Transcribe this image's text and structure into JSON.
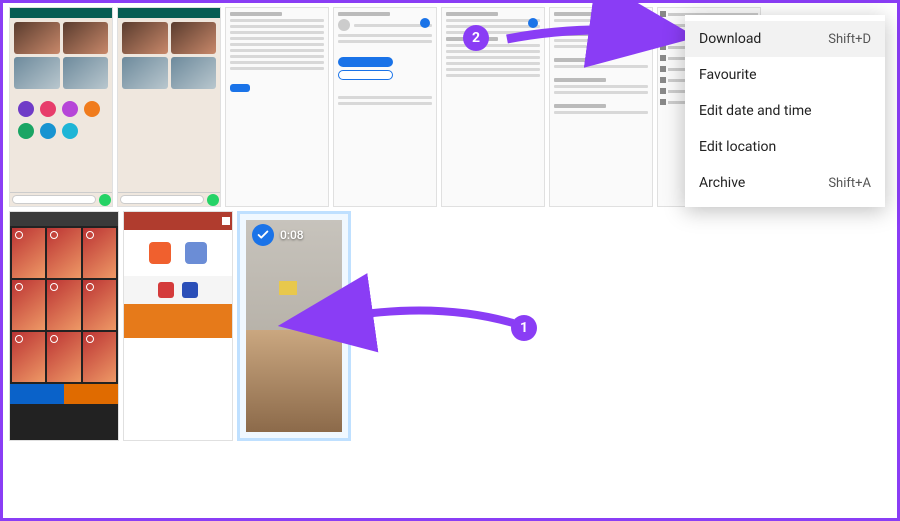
{
  "annotation": {
    "step1": "1",
    "step2": "2"
  },
  "selected_video": {
    "timestamp": "0:08",
    "checked": true
  },
  "context_menu": {
    "items": [
      {
        "label": "Download",
        "shortcut": "Shift+D",
        "highlighted": true
      },
      {
        "label": "Favourite",
        "shortcut": ""
      },
      {
        "label": "Edit date and time",
        "shortcut": ""
      },
      {
        "label": "Edit location",
        "shortcut": ""
      },
      {
        "label": "Archive",
        "shortcut": "Shift+A"
      }
    ]
  }
}
